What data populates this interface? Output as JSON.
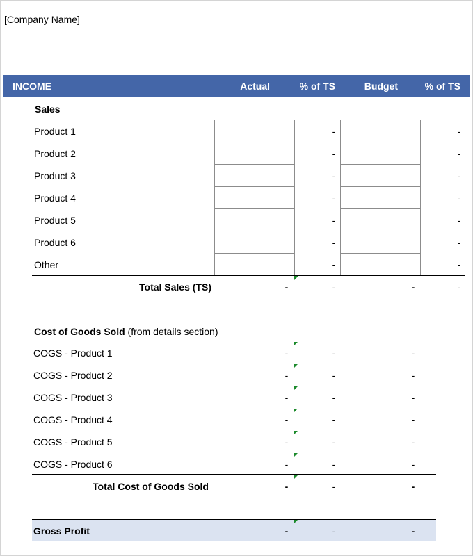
{
  "company": "[Company Name]",
  "header": {
    "income": "INCOME",
    "actual": "Actual",
    "pct_ts_1": "% of TS",
    "budget": "Budget",
    "pct_ts_2": "% of TS"
  },
  "sales": {
    "title": "Sales",
    "rows": [
      "Product 1",
      "Product 2",
      "Product 3",
      "Product 4",
      "Product 5",
      "Product 6",
      "Other"
    ],
    "total_label": "Total Sales (TS)"
  },
  "cogs": {
    "title": "Cost of Goods Sold",
    "note": "(from details section)",
    "rows": [
      "COGS - Product 1",
      "COGS - Product 2",
      "COGS - Product 3",
      "COGS - Product 4",
      "COGS - Product 5",
      "COGS - Product 6"
    ],
    "total_label": "Total Cost of Goods Sold"
  },
  "gross_profit": {
    "label": "Gross Profit"
  },
  "dash": "-"
}
